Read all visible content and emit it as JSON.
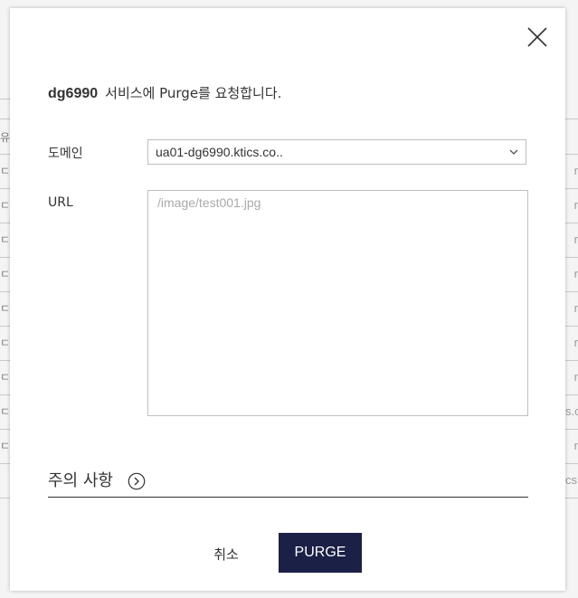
{
  "background": {
    "left_glyphs": [
      "유",
      "ㄷ",
      "ㄷ",
      "ㄷ",
      "ㄷ",
      "ㄷ",
      "ㄷ",
      "ㄷ",
      "ㄷ",
      "ㄷ"
    ],
    "right_glyphs": [
      "r",
      "r",
      "r",
      "r",
      "r",
      "r",
      "r",
      "s.c",
      "r",
      "cs."
    ]
  },
  "modal": {
    "close_icon": "close-icon",
    "title": {
      "service_id": "dg6990",
      "message": "서비스에 Purge를 요청합니다."
    },
    "domain": {
      "label": "도메인",
      "selected": "ua01-dg6990.ktics.co..",
      "chevron_icon": "chevron-down-icon"
    },
    "url": {
      "label": "URL",
      "placeholder": "/image/test001.jpg",
      "value": ""
    },
    "notice": {
      "label": "주의 사항",
      "icon": "chevron-right-circle-icon"
    },
    "actions": {
      "cancel_label": "취소",
      "purge_label": "PURGE"
    }
  }
}
